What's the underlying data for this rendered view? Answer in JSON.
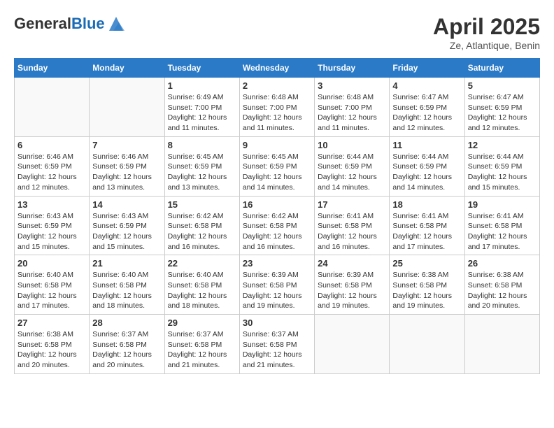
{
  "header": {
    "logo_general": "General",
    "logo_blue": "Blue",
    "month_title": "April 2025",
    "subtitle": "Ze, Atlantique, Benin"
  },
  "days_of_week": [
    "Sunday",
    "Monday",
    "Tuesday",
    "Wednesday",
    "Thursday",
    "Friday",
    "Saturday"
  ],
  "weeks": [
    [
      {
        "day": "",
        "info": ""
      },
      {
        "day": "",
        "info": ""
      },
      {
        "day": "1",
        "info": "Sunrise: 6:49 AM\nSunset: 7:00 PM\nDaylight: 12 hours and 11 minutes."
      },
      {
        "day": "2",
        "info": "Sunrise: 6:48 AM\nSunset: 7:00 PM\nDaylight: 12 hours and 11 minutes."
      },
      {
        "day": "3",
        "info": "Sunrise: 6:48 AM\nSunset: 7:00 PM\nDaylight: 12 hours and 11 minutes."
      },
      {
        "day": "4",
        "info": "Sunrise: 6:47 AM\nSunset: 6:59 PM\nDaylight: 12 hours and 12 minutes."
      },
      {
        "day": "5",
        "info": "Sunrise: 6:47 AM\nSunset: 6:59 PM\nDaylight: 12 hours and 12 minutes."
      }
    ],
    [
      {
        "day": "6",
        "info": "Sunrise: 6:46 AM\nSunset: 6:59 PM\nDaylight: 12 hours and 12 minutes."
      },
      {
        "day": "7",
        "info": "Sunrise: 6:46 AM\nSunset: 6:59 PM\nDaylight: 12 hours and 13 minutes."
      },
      {
        "day": "8",
        "info": "Sunrise: 6:45 AM\nSunset: 6:59 PM\nDaylight: 12 hours and 13 minutes."
      },
      {
        "day": "9",
        "info": "Sunrise: 6:45 AM\nSunset: 6:59 PM\nDaylight: 12 hours and 14 minutes."
      },
      {
        "day": "10",
        "info": "Sunrise: 6:44 AM\nSunset: 6:59 PM\nDaylight: 12 hours and 14 minutes."
      },
      {
        "day": "11",
        "info": "Sunrise: 6:44 AM\nSunset: 6:59 PM\nDaylight: 12 hours and 14 minutes."
      },
      {
        "day": "12",
        "info": "Sunrise: 6:44 AM\nSunset: 6:59 PM\nDaylight: 12 hours and 15 minutes."
      }
    ],
    [
      {
        "day": "13",
        "info": "Sunrise: 6:43 AM\nSunset: 6:59 PM\nDaylight: 12 hours and 15 minutes."
      },
      {
        "day": "14",
        "info": "Sunrise: 6:43 AM\nSunset: 6:59 PM\nDaylight: 12 hours and 15 minutes."
      },
      {
        "day": "15",
        "info": "Sunrise: 6:42 AM\nSunset: 6:58 PM\nDaylight: 12 hours and 16 minutes."
      },
      {
        "day": "16",
        "info": "Sunrise: 6:42 AM\nSunset: 6:58 PM\nDaylight: 12 hours and 16 minutes."
      },
      {
        "day": "17",
        "info": "Sunrise: 6:41 AM\nSunset: 6:58 PM\nDaylight: 12 hours and 16 minutes."
      },
      {
        "day": "18",
        "info": "Sunrise: 6:41 AM\nSunset: 6:58 PM\nDaylight: 12 hours and 17 minutes."
      },
      {
        "day": "19",
        "info": "Sunrise: 6:41 AM\nSunset: 6:58 PM\nDaylight: 12 hours and 17 minutes."
      }
    ],
    [
      {
        "day": "20",
        "info": "Sunrise: 6:40 AM\nSunset: 6:58 PM\nDaylight: 12 hours and 17 minutes."
      },
      {
        "day": "21",
        "info": "Sunrise: 6:40 AM\nSunset: 6:58 PM\nDaylight: 12 hours and 18 minutes."
      },
      {
        "day": "22",
        "info": "Sunrise: 6:40 AM\nSunset: 6:58 PM\nDaylight: 12 hours and 18 minutes."
      },
      {
        "day": "23",
        "info": "Sunrise: 6:39 AM\nSunset: 6:58 PM\nDaylight: 12 hours and 19 minutes."
      },
      {
        "day": "24",
        "info": "Sunrise: 6:39 AM\nSunset: 6:58 PM\nDaylight: 12 hours and 19 minutes."
      },
      {
        "day": "25",
        "info": "Sunrise: 6:38 AM\nSunset: 6:58 PM\nDaylight: 12 hours and 19 minutes."
      },
      {
        "day": "26",
        "info": "Sunrise: 6:38 AM\nSunset: 6:58 PM\nDaylight: 12 hours and 20 minutes."
      }
    ],
    [
      {
        "day": "27",
        "info": "Sunrise: 6:38 AM\nSunset: 6:58 PM\nDaylight: 12 hours and 20 minutes."
      },
      {
        "day": "28",
        "info": "Sunrise: 6:37 AM\nSunset: 6:58 PM\nDaylight: 12 hours and 20 minutes."
      },
      {
        "day": "29",
        "info": "Sunrise: 6:37 AM\nSunset: 6:58 PM\nDaylight: 12 hours and 21 minutes."
      },
      {
        "day": "30",
        "info": "Sunrise: 6:37 AM\nSunset: 6:58 PM\nDaylight: 12 hours and 21 minutes."
      },
      {
        "day": "",
        "info": ""
      },
      {
        "day": "",
        "info": ""
      },
      {
        "day": "",
        "info": ""
      }
    ]
  ]
}
